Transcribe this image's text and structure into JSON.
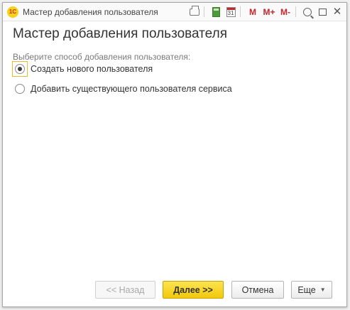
{
  "window": {
    "title": "Мастер добавления пользователя",
    "logo_text": "1С",
    "toolbar": {
      "m_label": "M",
      "m_plus_label": "M+",
      "m_minus_label": "M-",
      "calendar_day": "31"
    }
  },
  "page": {
    "title": "Мастер добавления пользователя",
    "prompt": "Выберите способ добавления пользователя:",
    "options": [
      {
        "label": "Создать нового пользователя",
        "selected": true
      },
      {
        "label": "Добавить существующего пользователя сервиса",
        "selected": false
      }
    ]
  },
  "buttons": {
    "back": "<< Назад",
    "next": "Далее >>",
    "cancel": "Отмена",
    "more": "Еще"
  },
  "colors": {
    "accent_yellow": "#f5d21b",
    "brand_red": "#c1272d",
    "focus_border": "#e0c030"
  }
}
